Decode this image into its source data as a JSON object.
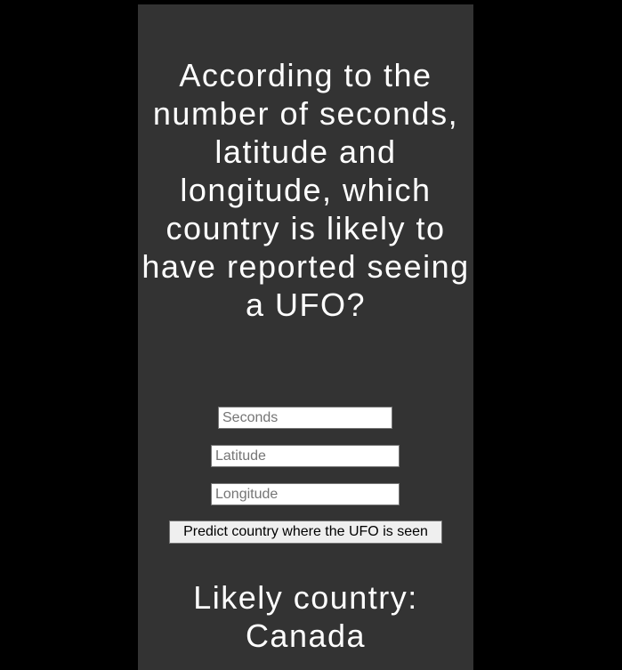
{
  "page": {
    "heading": "According to the number of seconds, latitude and longitude, which country is likely to have reported seeing a UFO?"
  },
  "form": {
    "seconds_placeholder": "Seconds",
    "latitude_placeholder": "Latitude",
    "longitude_placeholder": "Longitude",
    "submit_label": "Predict country where the UFO is seen"
  },
  "result": {
    "text": "Likely country: Canada"
  },
  "colors": {
    "page_background": "#000000",
    "panel_background": "#333333",
    "text": "#ffffff"
  }
}
